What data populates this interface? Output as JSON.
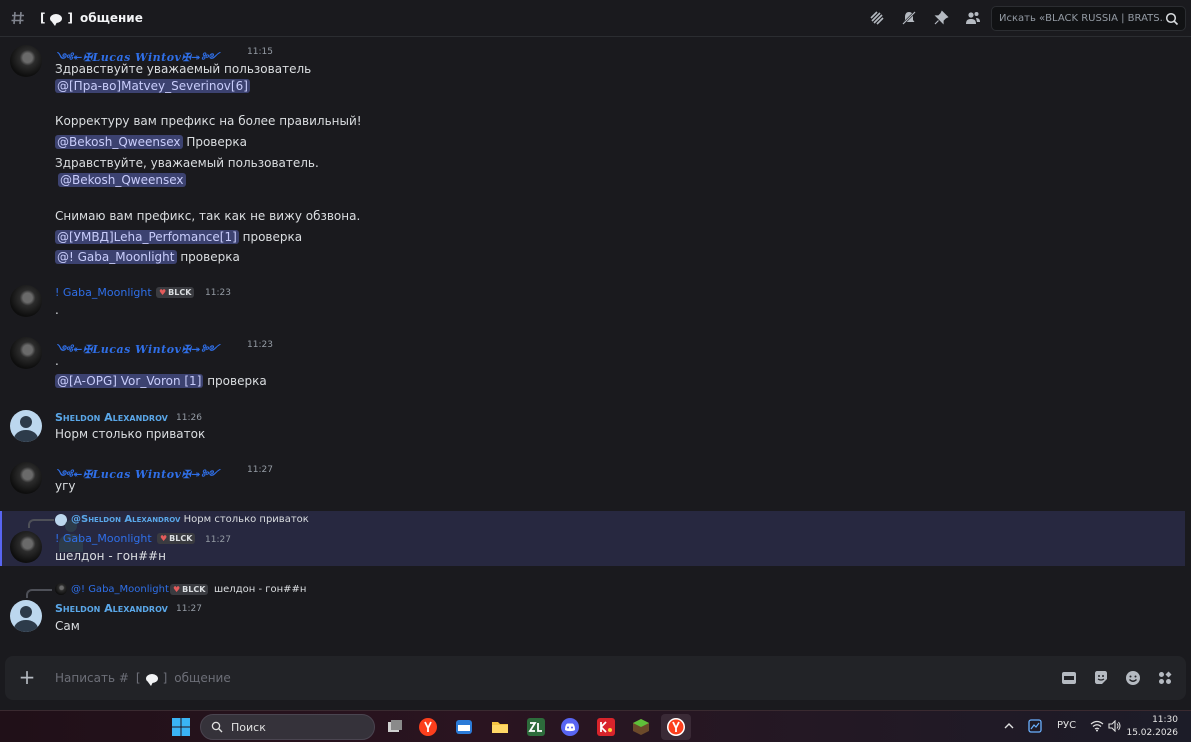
{
  "header": {
    "title_prefix": "[",
    "title_suffix": "]",
    "title": "общение",
    "search_placeholder": "Искать «BLACK RUSSIA | BRATS..."
  },
  "messages": [
    {
      "author": "༺↞✠𝑳𝒖𝒄𝒂𝒔 𝑾𝒊𝒏𝒕𝒐𝒗✠↠༻",
      "time": "11:15",
      "lines": [
        "Здравствуйте уважаемый пользователь",
        "@[Пра-во]Matvey_Severinov[6]",
        "Корректуру вам префикс на более правильный!",
        "@Bekosh_Qweensex",
        "Проверка",
        "Здравствуйте, уважаемый пользователь.",
        "@Bekosh_Qweensex",
        "Снимаю вам префикс, так как не вижу обзвона.",
        "@[УМВД]Leha_Perfomance[1]",
        "проверка",
        "@! Gaba_Moonlight",
        "проверка"
      ]
    },
    {
      "author": "! Gaba_Moonlight",
      "tag": "BLCK",
      "time": "11:23",
      "lines": [
        "."
      ]
    },
    {
      "author": "༺↞✠𝑳𝒖𝒄𝒂𝒔 𝑾𝒊𝒏𝒕𝒐𝒗✠↠༻",
      "time": "11:23",
      "lines": [
        ".",
        "@[A-OPG] Vor_Voron [1]",
        "проверка"
      ]
    },
    {
      "author": "Sheldon Alexandrov",
      "time": "11:26",
      "lines": [
        "Норм столько приваток"
      ]
    },
    {
      "author": "༺↞✠𝑳𝒖𝒄𝒂𝒔 𝑾𝒊𝒏𝒕𝒐𝒗✠↠༻",
      "time": "11:27",
      "lines": [
        "угу"
      ]
    },
    {
      "reply_to": {
        "author": "@Sheldon Alexandrov",
        "text": "Норм столько приваток"
      },
      "author": "! Gaba_Moonlight",
      "tag": "BLCK",
      "time": "11:27",
      "lines": [
        "шелдон - гон##н"
      ]
    },
    {
      "reply_to": {
        "author": "@! Gaba_Moonlight",
        "tag": "BLCK",
        "text": "шелдон - гон##н"
      },
      "author": "Sheldon Alexandrov",
      "time": "11:27",
      "lines": [
        "Сам"
      ]
    }
  ],
  "composer": {
    "placeholder_prefix": "Написать #",
    "placeholder_open": "[",
    "placeholder_close": "]",
    "placeholder_channel": "общение"
  },
  "taskbar": {
    "search_label": "Поиск",
    "language": "РУС",
    "time": "11:30",
    "date": "15.02.2026"
  },
  "colors": {
    "mention_bg": "#3c4270",
    "accent": "#5865f2",
    "name_blue": "#2f6fe8",
    "sheldon": "#5aa7e8"
  }
}
